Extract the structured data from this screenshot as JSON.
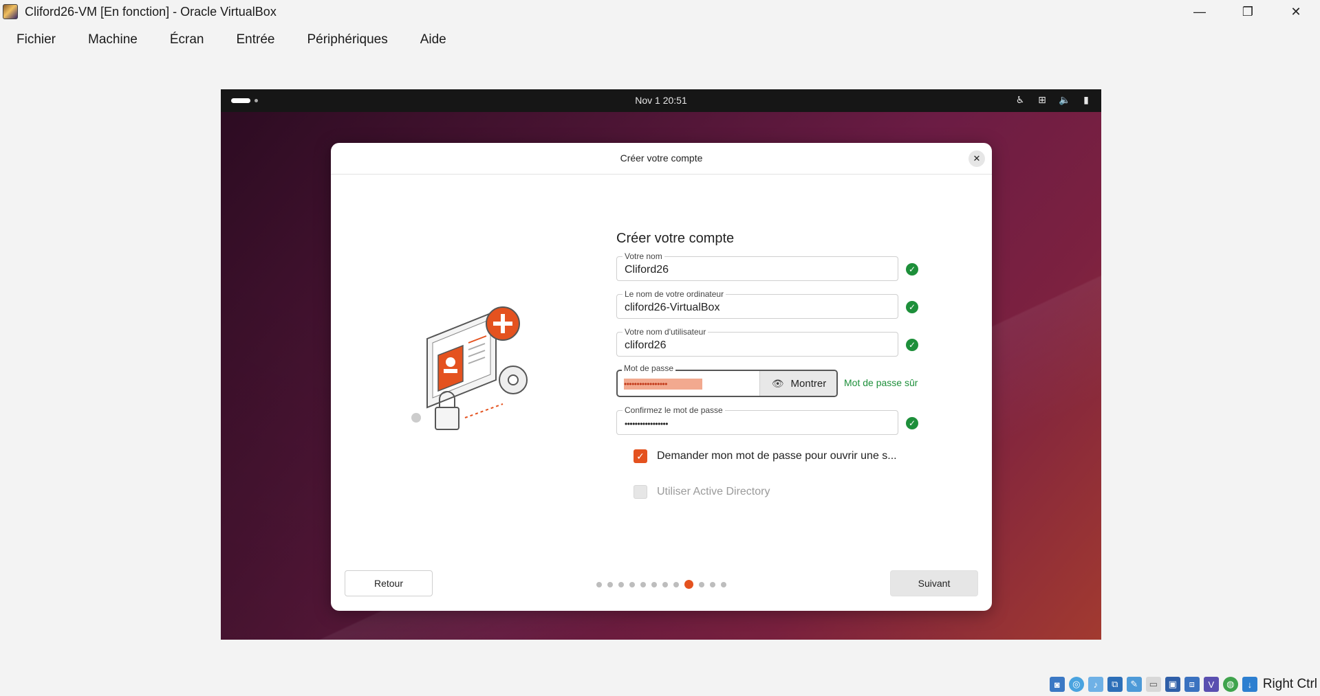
{
  "window": {
    "title": "Cliford26-VM [En fonction] - Oracle VirtualBox",
    "controls": {
      "minimize": "—",
      "restore": "❐",
      "close": "✕"
    }
  },
  "menu": [
    "Fichier",
    "Machine",
    "Écran",
    "Entrée",
    "Périphériques",
    "Aide"
  ],
  "guest": {
    "clock": "Nov 1  20:51",
    "tray_icons": [
      "accessibility-icon",
      "network-icon",
      "volume-icon",
      "battery-icon"
    ]
  },
  "dialog": {
    "title": "Créer votre compte",
    "heading": "Créer votre compte",
    "fields": {
      "name": {
        "label": "Votre nom",
        "value": "Cliford26"
      },
      "computer": {
        "label": "Le nom de votre ordinateur",
        "value": "cliford26-VirtualBox"
      },
      "username": {
        "label": "Votre nom d'utilisateur",
        "value": "cliford26"
      },
      "password": {
        "label": "Mot de passe",
        "value": "•••••••••••••••••",
        "show_label": "Montrer",
        "strength": "Mot de passe sûr"
      },
      "confirm": {
        "label": "Confirmez le mot de passe",
        "value": "•••••••••••••••••"
      }
    },
    "options": {
      "require_password": {
        "label": "Demander mon mot de passe pour ouvrir une s...",
        "checked": true
      },
      "active_directory": {
        "label": "Utiliser Active Directory",
        "checked": false
      }
    },
    "back_label": "Retour",
    "next_label": "Suivant",
    "pager": {
      "total": 12,
      "current": 9
    }
  },
  "statusbar": {
    "host_key": "Right Ctrl"
  },
  "colors": {
    "accent": "#e4521f",
    "success": "#1d8f3a"
  }
}
